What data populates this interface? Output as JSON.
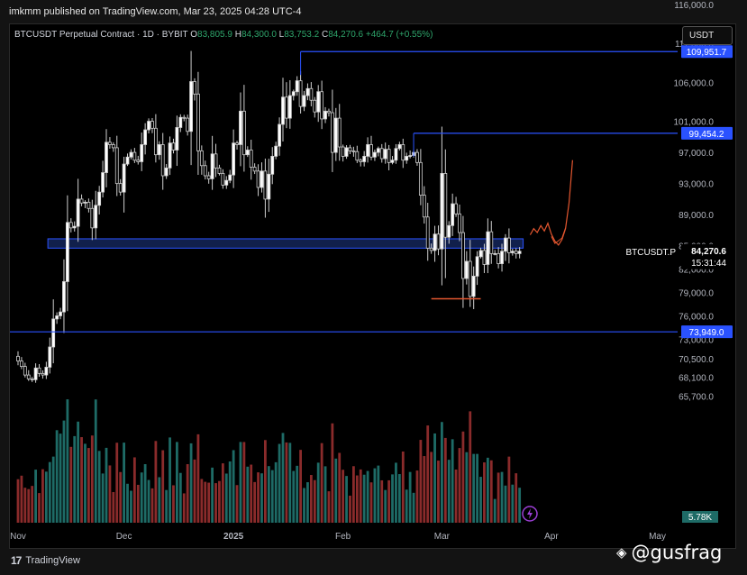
{
  "header": {
    "published_line": "imkmm published on TradingView.com, Mar 23, 2025 04:28 UTC-4",
    "symbol_desc": "BTCUSDT Perpetual Contract · 1D · BYBIT",
    "o_label": "O",
    "o_value": "83,805.9",
    "h_label": "H",
    "h_value": "84,300.0",
    "l_label": "L",
    "l_value": "83,753.2",
    "c_label": "C",
    "c_value": "84,270.6",
    "change": "+464.7 (+0.55%)",
    "currency_button": "USDT"
  },
  "footer": {
    "brand": "TradingView",
    "brand_mark": "17",
    "author_handle": "@gusfrag"
  },
  "colors": {
    "up": "#ffffff",
    "down": "#000000",
    "up_volume": "#1e6b66",
    "down_volume": "#8a2b2b",
    "level_line": "#2a52ff",
    "zone_fill": "#1f3b8a",
    "annotation": "#e3562f",
    "background": "#000000"
  },
  "chart_data": {
    "type": "candlestick",
    "timeframe": "1D",
    "symbol": "BTCUSDT.P",
    "price_label": "84,270.6",
    "countdown": "15:31:44",
    "volume_label": "5.78K",
    "ylim": [
      64000,
      119000
    ],
    "y_ticks": [
      {
        "v": 116000,
        "label": "116,000.0"
      },
      {
        "v": 111000,
        "label": "111,000.0"
      },
      {
        "v": 106000,
        "label": "106,000.0"
      },
      {
        "v": 101000,
        "label": "101,000.0"
      },
      {
        "v": 97000,
        "label": "97,000.0"
      },
      {
        "v": 93000,
        "label": "93,000.0"
      },
      {
        "v": 89000,
        "label": "89,000.0"
      },
      {
        "v": 85000,
        "label": "85,000.0"
      },
      {
        "v": 82000,
        "label": "82,000.0"
      },
      {
        "v": 79000,
        "label": "79,000.0"
      },
      {
        "v": 76000,
        "label": "76,000.0"
      },
      {
        "v": 73000,
        "label": "73,000.0"
      },
      {
        "v": 70500,
        "label": "70,500.0"
      },
      {
        "v": 68100,
        "label": "68,100.0"
      },
      {
        "v": 65700,
        "label": "65,700.0"
      }
    ],
    "x_ticks": [
      {
        "day": 0,
        "label": "Nov"
      },
      {
        "day": 30,
        "label": "Dec"
      },
      {
        "day": 61,
        "label": "2025"
      },
      {
        "day": 92,
        "label": "Feb"
      },
      {
        "day": 120,
        "label": "Mar"
      },
      {
        "day": 151,
        "label": "Apr"
      },
      {
        "day": 181,
        "label": "May"
      }
    ],
    "levels": [
      {
        "value": 109951.7,
        "label": "109,951.7",
        "from_day": 80
      },
      {
        "value": 99454.2,
        "label": "99,454.2",
        "from_day": 112
      },
      {
        "value": 73949.0,
        "label": "73,949.0",
        "from_day": -5
      }
    ],
    "support_zone": {
      "from_day": 11,
      "to_day": 143,
      "low": 84700,
      "high": 85900
    },
    "low_marker": {
      "from_day": 117,
      "to_day": 131,
      "value": 78200
    },
    "closes": [
      70200,
      69500,
      68400,
      67900,
      67800,
      69300,
      68600,
      68400,
      69400,
      72000,
      75600,
      76000,
      76500,
      80400,
      88000,
      87300,
      87500,
      91000,
      90500,
      90600,
      89800,
      87300,
      90200,
      91900,
      94400,
      98300,
      98000,
      97600,
      93000,
      91900,
      95500,
      96400,
      97000,
      96000,
      95800,
      98000,
      99900,
      101000,
      100100,
      96700,
      98000,
      94000,
      95000,
      98200,
      97300,
      100200,
      101500,
      101400,
      99700,
      106100,
      104500,
      97200,
      95300,
      94000,
      93600,
      96800,
      95000,
      94300,
      92800,
      93400,
      94100,
      98200,
      98000,
      102300,
      96700,
      97300,
      95100,
      94600,
      92500,
      94600,
      91000,
      94200,
      96500,
      97800,
      100600,
      104100,
      101400,
      104300,
      104800,
      106200,
      102900,
      104300,
      105200,
      103700,
      102200,
      104800,
      101300,
      102300,
      102100,
      97000,
      101400,
      97700,
      96500,
      97600,
      97200,
      97100,
      96000,
      95800,
      96500,
      98000,
      96400,
      97000,
      97500,
      96200,
      97400,
      95700,
      96000,
      97500,
      98000,
      96000,
      96500,
      96600,
      97000,
      95700,
      91500,
      88700,
      84700,
      84400,
      86500,
      84600,
      94300,
      86100,
      87600,
      90400,
      89100,
      86700,
      80800,
      83000,
      78500,
      81100,
      83600,
      84400,
      82600,
      86800,
      84000,
      84000,
      82700,
      84300,
      86000,
      84100,
      84300,
      84000,
      84300
    ]
  }
}
